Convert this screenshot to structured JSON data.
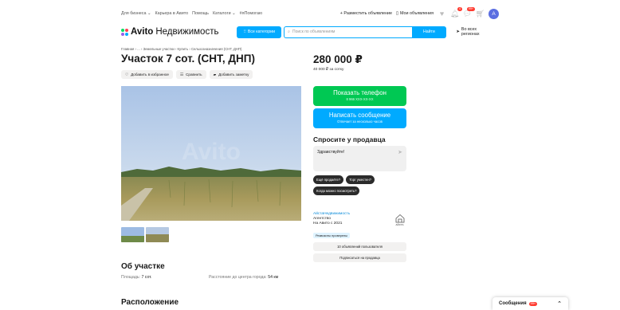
{
  "topbar": {
    "links": [
      "Для бизнеса ⌄",
      "Карьера в Авито",
      "Помощь",
      "Каталоги ⌄",
      "#яПомогаю"
    ],
    "post_ad": "+ Разместить объявление",
    "my_ads": "Мои объявления",
    "notif_count": "4",
    "msg_count": "99+",
    "avatar_letter": "A"
  },
  "header": {
    "logo_brand": "Avito",
    "logo_section": "Недвижимость",
    "categories_label": "Все категории",
    "search_placeholder": "Поиск по объявлениям",
    "find_label": "Найти",
    "region_label": "Во всех регионах"
  },
  "breadcrumbs": "Главная › ... › Земельные участки › Купить › Сельхозназначения (СНТ, ДНП)",
  "listing": {
    "title": "Участок 7 сот. (СНТ, ДНП)",
    "actions": [
      {
        "icon": "heart-icon",
        "label": "Добавить в избранное"
      },
      {
        "icon": "compare-icon",
        "label": "Сравнить"
      },
      {
        "icon": "note-icon",
        "label": "Добавить заметку"
      }
    ],
    "photo_watermark": "Avito",
    "about_title": "Об участке",
    "area_label": "Площадь:",
    "area_value": "7 сот.",
    "distance_label": "Расстояние до центра города:",
    "distance_value": "54 км",
    "location_title": "Расположение"
  },
  "sidebar": {
    "price": "280 000 ₽",
    "price_per": "40 000 ₽ за сотку",
    "phone_label": "Показать телефон",
    "phone_number": "8 966 XXX-XX-XX",
    "message_label": "Написать сообщение",
    "message_sub": "Отвечает за несколько часов",
    "ask_title": "Спросите у продавца",
    "ask_text": "Здравствуйте!",
    "quick_questions": [
      "Ещё продаёте?",
      "Торг уместен?",
      "Когда можно посмотреть?"
    ],
    "seller_name": "АйстаНедвижимость",
    "seller_type": "Агентство",
    "seller_since": "На Авито с 2021",
    "seller_logo_text": "АЙСТА",
    "verified": "Реквизиты проверены",
    "other_ads": "10 объявлений пользователя",
    "subscribe": "Подписаться на продавца"
  },
  "messages_widget": {
    "label": "Сообщения",
    "count": "99+"
  },
  "colors": {
    "accent_blue": "#00aaff",
    "green": "#00c853",
    "badge_red": "#ff3b30"
  }
}
